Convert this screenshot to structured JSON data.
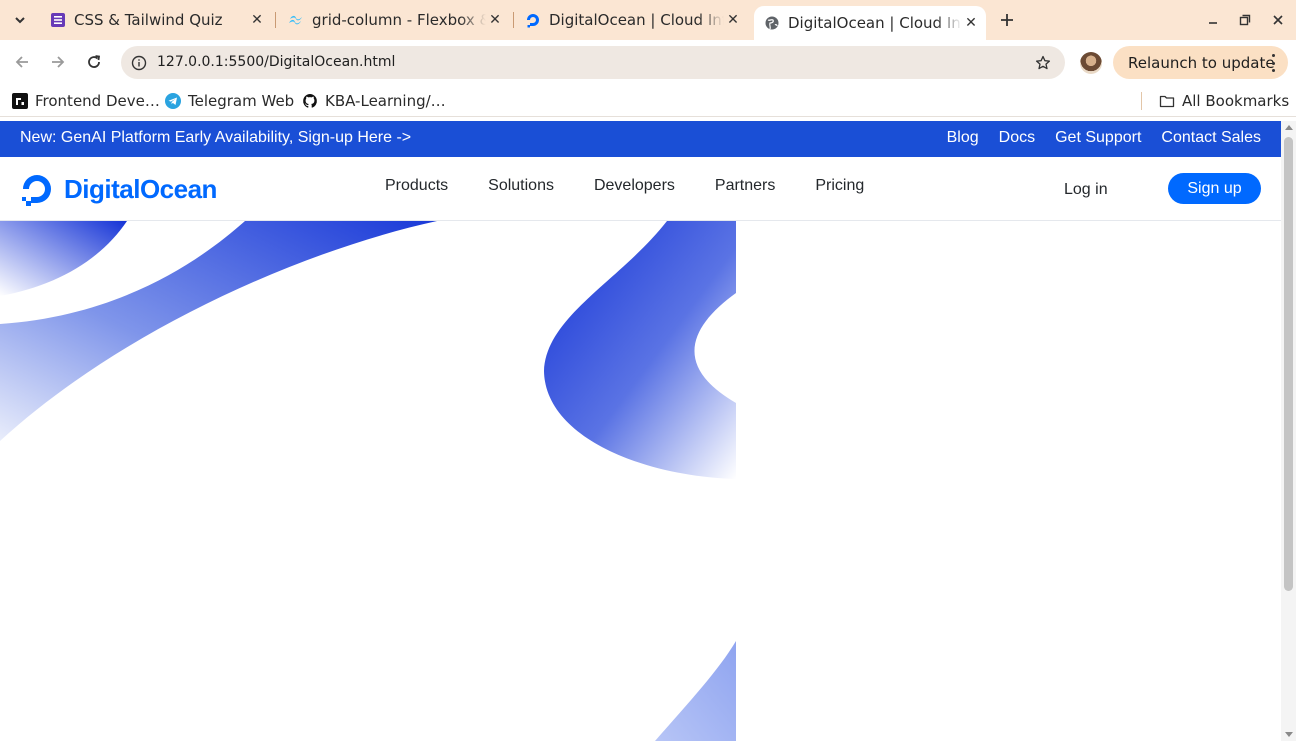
{
  "browser": {
    "tabs": [
      {
        "title": "CSS & Tailwind Quiz",
        "favicon": "form-icon"
      },
      {
        "title": "grid-column - Flexbox & Grid",
        "favicon": "tailwind-icon"
      },
      {
        "title": "DigitalOcean | Cloud Infrastructure",
        "favicon": "digitalocean-icon"
      },
      {
        "title": "DigitalOcean | Cloud Infrastructure",
        "favicon": "globe-icon",
        "active": true
      }
    ],
    "address": "127.0.0.1:5500/DigitalOcean.html",
    "relaunch_label": "Relaunch to update",
    "bookmarks": [
      {
        "label": "Frontend Deve…",
        "icon": "frontend-icon"
      },
      {
        "label": "Telegram Web",
        "icon": "telegram-icon"
      },
      {
        "label": "KBA-Learning/…",
        "icon": "github-icon"
      }
    ],
    "all_bookmarks_label": "All Bookmarks"
  },
  "page": {
    "announcement": "New: GenAI Platform Early Availability, Sign-up Here ->",
    "top_links": [
      "Blog",
      "Docs",
      "Get Support",
      "Contact Sales"
    ],
    "brand": "DigitalOcean",
    "menu": [
      "Products",
      "Solutions",
      "Developers",
      "Partners",
      "Pricing"
    ],
    "login_label": "Log in",
    "signup_label": "Sign up"
  },
  "colors": {
    "announcement_bg": "#1a4fd6",
    "brand_blue": "#0069ff",
    "chrome_tabbar": "#fbe6d3"
  }
}
